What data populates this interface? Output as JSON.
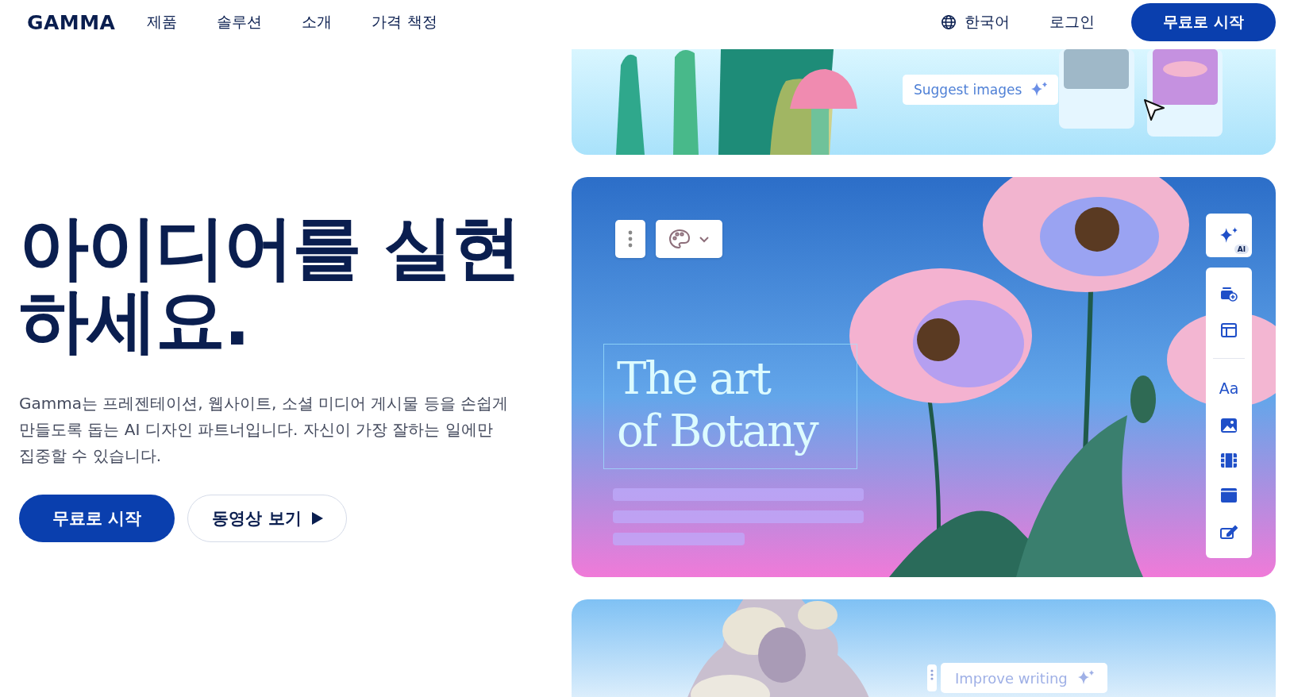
{
  "nav": {
    "logo": "GAMMA",
    "links": [
      "제품",
      "솔루션",
      "소개",
      "가격 책정"
    ],
    "language": "한국어",
    "login": "로그인",
    "cta": "무료로 시작"
  },
  "hero": {
    "title": "아이디어를 실현하세요.",
    "description": "Gamma는 프레젠테이션, 웹사이트, 소셜 미디어 게시물 등을 손쉽게 만들도록 돕는 AI 디자인 파트너입니다. 자신이 가장 잘하는 일에만 집중할 수 있습니다.",
    "primary_button": "무료로 시작",
    "secondary_button": "동영상 보기"
  },
  "cards": [
    {
      "kind": "suggest",
      "chip": "Suggest images"
    },
    {
      "kind": "editor",
      "title_lines": [
        "The art",
        "of Botany"
      ],
      "ai_badge": "AI",
      "text_tool": "Aa"
    },
    {
      "kind": "writing",
      "chip": "Improve writing"
    }
  ]
}
